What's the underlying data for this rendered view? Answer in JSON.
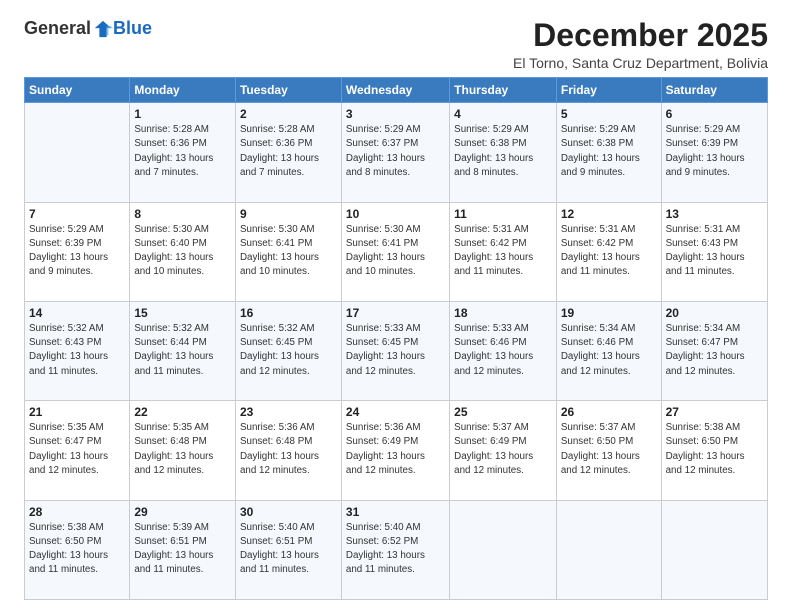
{
  "logo": {
    "general": "General",
    "blue": "Blue"
  },
  "header": {
    "month_title": "December 2025",
    "subtitle": "El Torno, Santa Cruz Department, Bolivia"
  },
  "weekdays": [
    "Sunday",
    "Monday",
    "Tuesday",
    "Wednesday",
    "Thursday",
    "Friday",
    "Saturday"
  ],
  "weeks": [
    [
      {
        "day": "",
        "info": ""
      },
      {
        "day": "1",
        "info": "Sunrise: 5:28 AM\nSunset: 6:36 PM\nDaylight: 13 hours\nand 7 minutes."
      },
      {
        "day": "2",
        "info": "Sunrise: 5:28 AM\nSunset: 6:36 PM\nDaylight: 13 hours\nand 7 minutes."
      },
      {
        "day": "3",
        "info": "Sunrise: 5:29 AM\nSunset: 6:37 PM\nDaylight: 13 hours\nand 8 minutes."
      },
      {
        "day": "4",
        "info": "Sunrise: 5:29 AM\nSunset: 6:38 PM\nDaylight: 13 hours\nand 8 minutes."
      },
      {
        "day": "5",
        "info": "Sunrise: 5:29 AM\nSunset: 6:38 PM\nDaylight: 13 hours\nand 9 minutes."
      },
      {
        "day": "6",
        "info": "Sunrise: 5:29 AM\nSunset: 6:39 PM\nDaylight: 13 hours\nand 9 minutes."
      }
    ],
    [
      {
        "day": "7",
        "info": "Sunrise: 5:29 AM\nSunset: 6:39 PM\nDaylight: 13 hours\nand 9 minutes."
      },
      {
        "day": "8",
        "info": "Sunrise: 5:30 AM\nSunset: 6:40 PM\nDaylight: 13 hours\nand 10 minutes."
      },
      {
        "day": "9",
        "info": "Sunrise: 5:30 AM\nSunset: 6:41 PM\nDaylight: 13 hours\nand 10 minutes."
      },
      {
        "day": "10",
        "info": "Sunrise: 5:30 AM\nSunset: 6:41 PM\nDaylight: 13 hours\nand 10 minutes."
      },
      {
        "day": "11",
        "info": "Sunrise: 5:31 AM\nSunset: 6:42 PM\nDaylight: 13 hours\nand 11 minutes."
      },
      {
        "day": "12",
        "info": "Sunrise: 5:31 AM\nSunset: 6:42 PM\nDaylight: 13 hours\nand 11 minutes."
      },
      {
        "day": "13",
        "info": "Sunrise: 5:31 AM\nSunset: 6:43 PM\nDaylight: 13 hours\nand 11 minutes."
      }
    ],
    [
      {
        "day": "14",
        "info": "Sunrise: 5:32 AM\nSunset: 6:43 PM\nDaylight: 13 hours\nand 11 minutes."
      },
      {
        "day": "15",
        "info": "Sunrise: 5:32 AM\nSunset: 6:44 PM\nDaylight: 13 hours\nand 11 minutes."
      },
      {
        "day": "16",
        "info": "Sunrise: 5:32 AM\nSunset: 6:45 PM\nDaylight: 13 hours\nand 12 minutes."
      },
      {
        "day": "17",
        "info": "Sunrise: 5:33 AM\nSunset: 6:45 PM\nDaylight: 13 hours\nand 12 minutes."
      },
      {
        "day": "18",
        "info": "Sunrise: 5:33 AM\nSunset: 6:46 PM\nDaylight: 13 hours\nand 12 minutes."
      },
      {
        "day": "19",
        "info": "Sunrise: 5:34 AM\nSunset: 6:46 PM\nDaylight: 13 hours\nand 12 minutes."
      },
      {
        "day": "20",
        "info": "Sunrise: 5:34 AM\nSunset: 6:47 PM\nDaylight: 13 hours\nand 12 minutes."
      }
    ],
    [
      {
        "day": "21",
        "info": "Sunrise: 5:35 AM\nSunset: 6:47 PM\nDaylight: 13 hours\nand 12 minutes."
      },
      {
        "day": "22",
        "info": "Sunrise: 5:35 AM\nSunset: 6:48 PM\nDaylight: 13 hours\nand 12 minutes."
      },
      {
        "day": "23",
        "info": "Sunrise: 5:36 AM\nSunset: 6:48 PM\nDaylight: 13 hours\nand 12 minutes."
      },
      {
        "day": "24",
        "info": "Sunrise: 5:36 AM\nSunset: 6:49 PM\nDaylight: 13 hours\nand 12 minutes."
      },
      {
        "day": "25",
        "info": "Sunrise: 5:37 AM\nSunset: 6:49 PM\nDaylight: 13 hours\nand 12 minutes."
      },
      {
        "day": "26",
        "info": "Sunrise: 5:37 AM\nSunset: 6:50 PM\nDaylight: 13 hours\nand 12 minutes."
      },
      {
        "day": "27",
        "info": "Sunrise: 5:38 AM\nSunset: 6:50 PM\nDaylight: 13 hours\nand 12 minutes."
      }
    ],
    [
      {
        "day": "28",
        "info": "Sunrise: 5:38 AM\nSunset: 6:50 PM\nDaylight: 13 hours\nand 11 minutes."
      },
      {
        "day": "29",
        "info": "Sunrise: 5:39 AM\nSunset: 6:51 PM\nDaylight: 13 hours\nand 11 minutes."
      },
      {
        "day": "30",
        "info": "Sunrise: 5:40 AM\nSunset: 6:51 PM\nDaylight: 13 hours\nand 11 minutes."
      },
      {
        "day": "31",
        "info": "Sunrise: 5:40 AM\nSunset: 6:52 PM\nDaylight: 13 hours\nand 11 minutes."
      },
      {
        "day": "",
        "info": ""
      },
      {
        "day": "",
        "info": ""
      },
      {
        "day": "",
        "info": ""
      }
    ]
  ]
}
